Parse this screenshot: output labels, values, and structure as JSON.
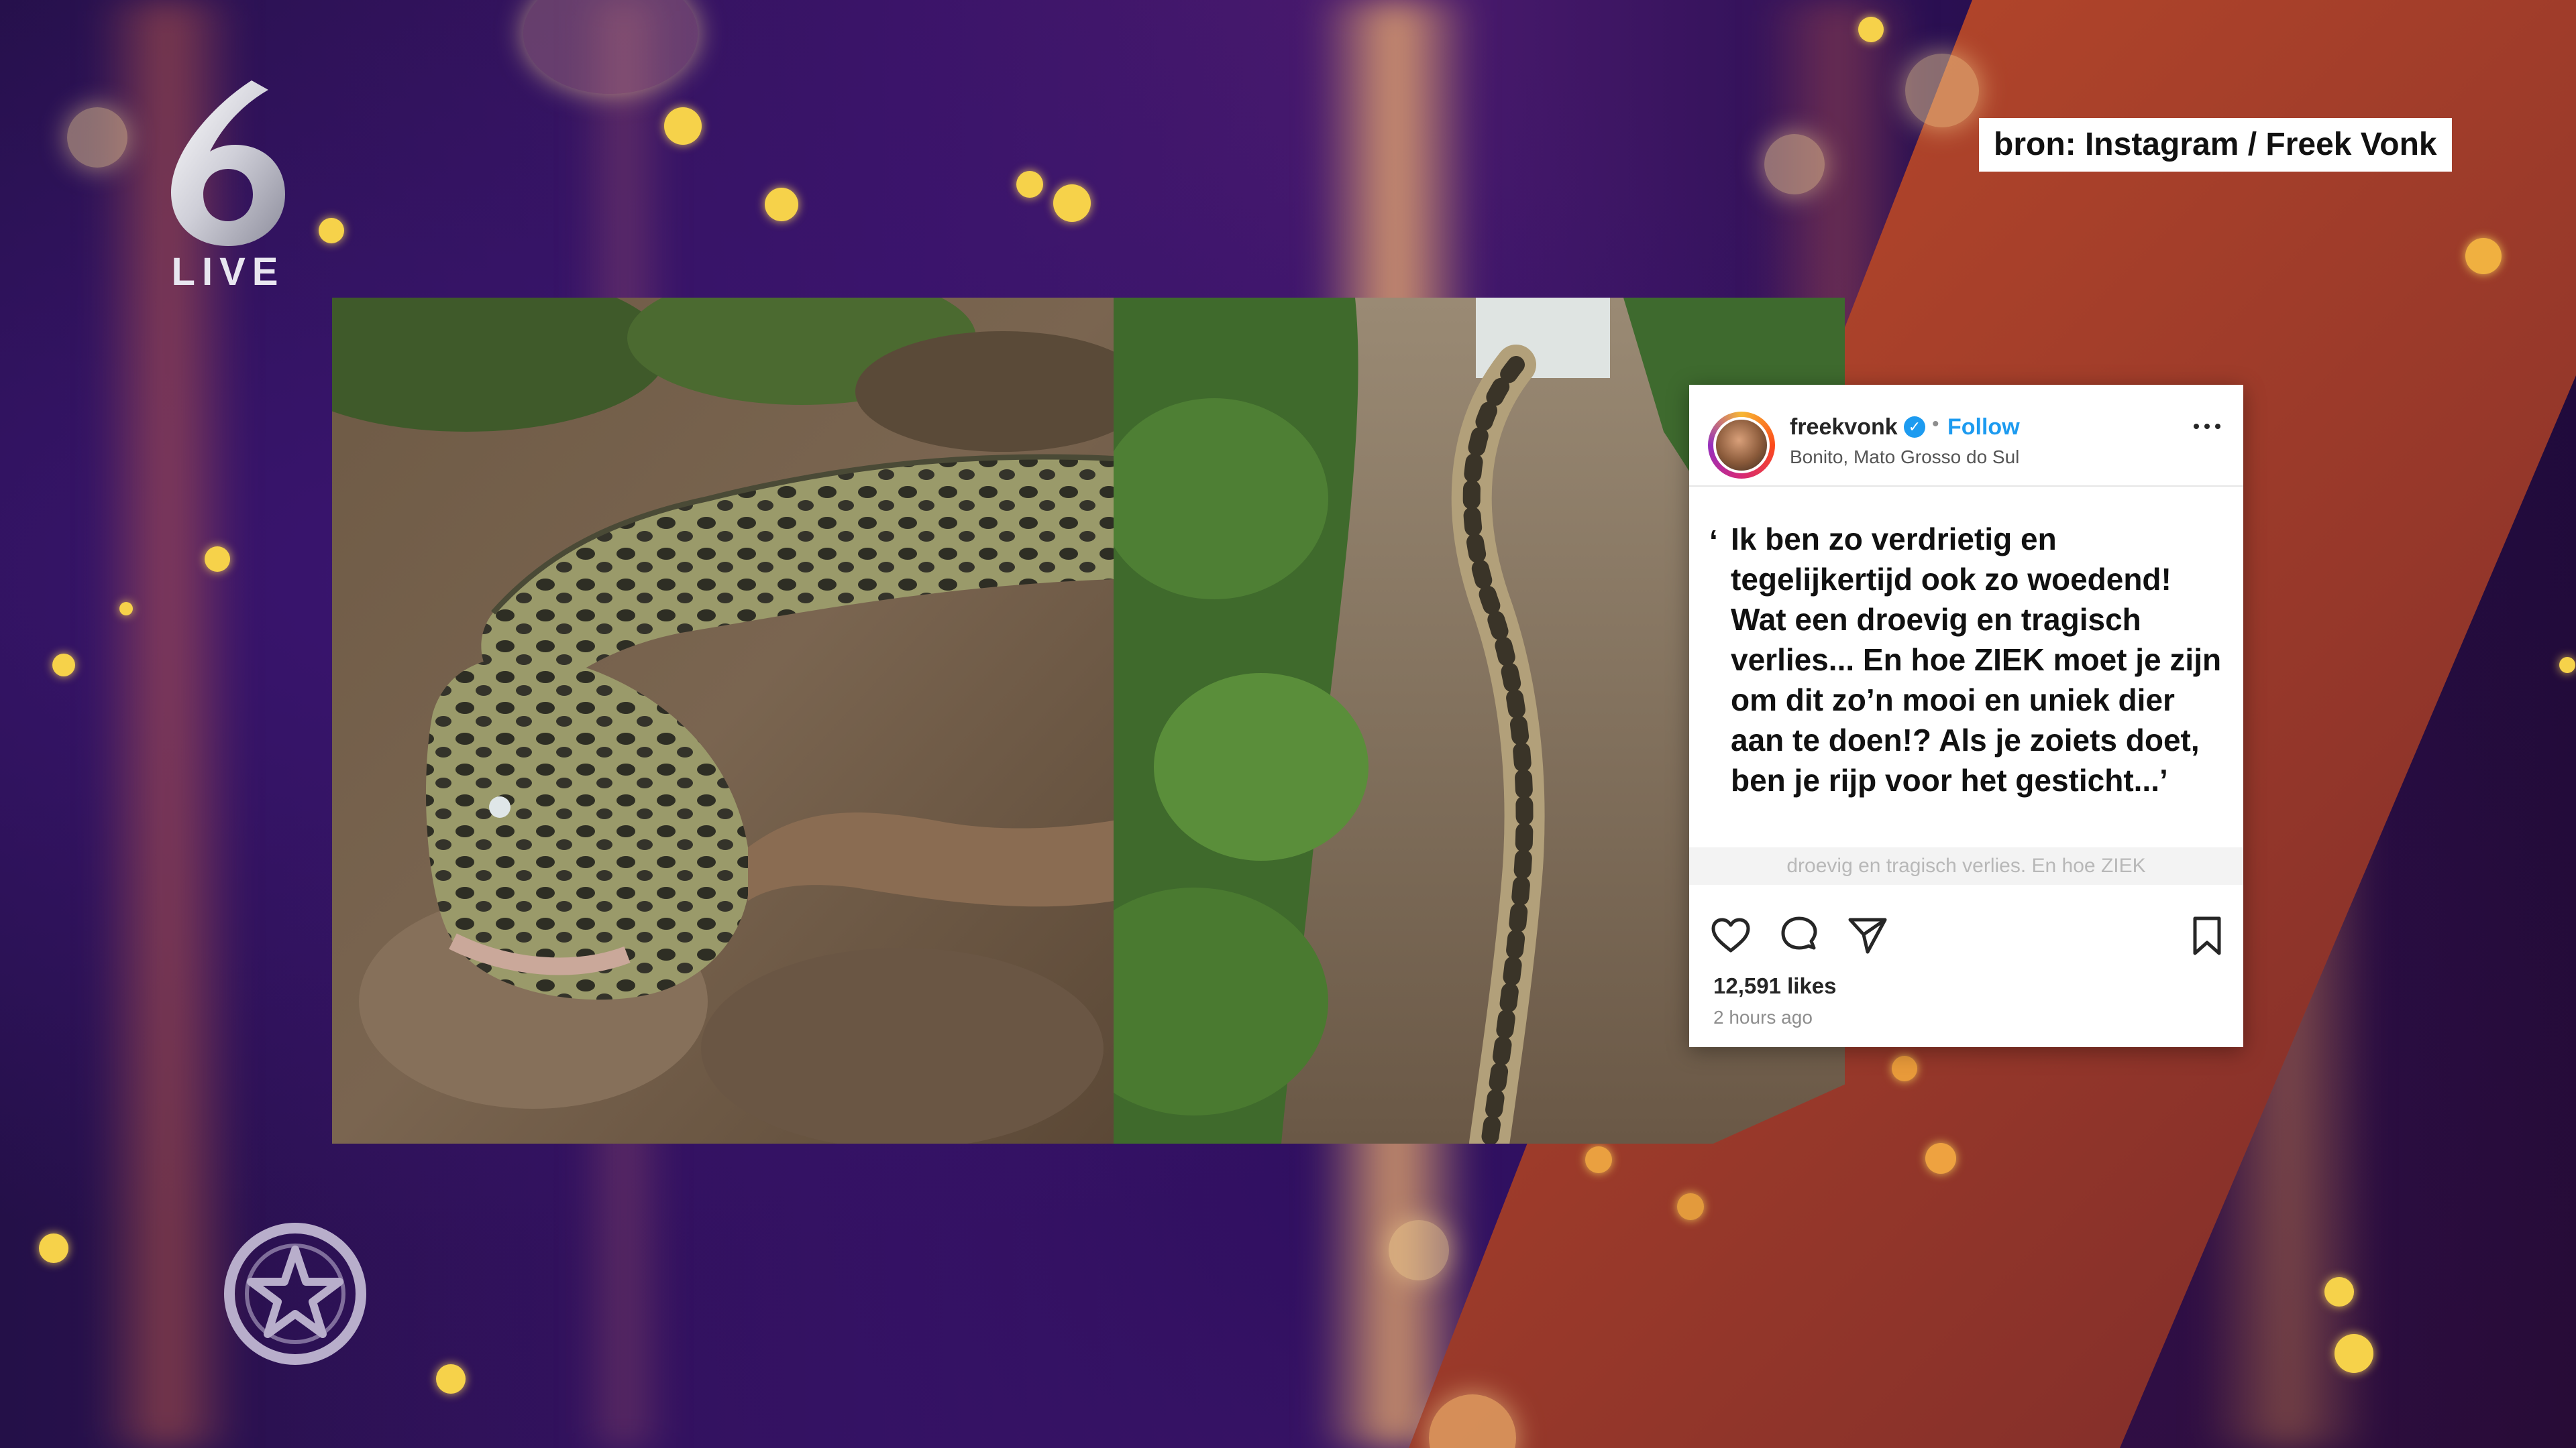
{
  "broadcast": {
    "channel_logo": {
      "numeral": "6",
      "label": "LIVE"
    },
    "source_caption": "bron: Instagram / Freek Vonk",
    "show_badge_icon": "star-in-circle-icon"
  },
  "instagram_post": {
    "username": "freekvonk",
    "verified_mark": "✓",
    "separator": "•",
    "follow_label": "Follow",
    "location": "Bonito, Mato Grosso do Sul",
    "quote_mark": "‘",
    "quote": "Ik ben zo verdrietig en tegelijkertijd ook zo woedend! Wat een droevig en tragisch verlies... En hoe ZIEK moet je zijn om dit zo’n mooi en uniek dier aan te doen!? Als je zoiets doet, ben je rijp voor het gesticht...’",
    "caption_fragment": "droevig en tragisch verlies. En hoe ZIEK",
    "likes": "12,591 likes",
    "time_ago": "2 hours ago",
    "icons": [
      "heart-icon",
      "comment-icon",
      "share-icon",
      "bookmark-icon",
      "more-options-icon"
    ]
  },
  "colors": {
    "background_purple": "#2a0d4e",
    "stripe_orange": "#e07a38",
    "instagram_blue": "#1d9bf0",
    "confetti_gold": "#f6d24a"
  }
}
